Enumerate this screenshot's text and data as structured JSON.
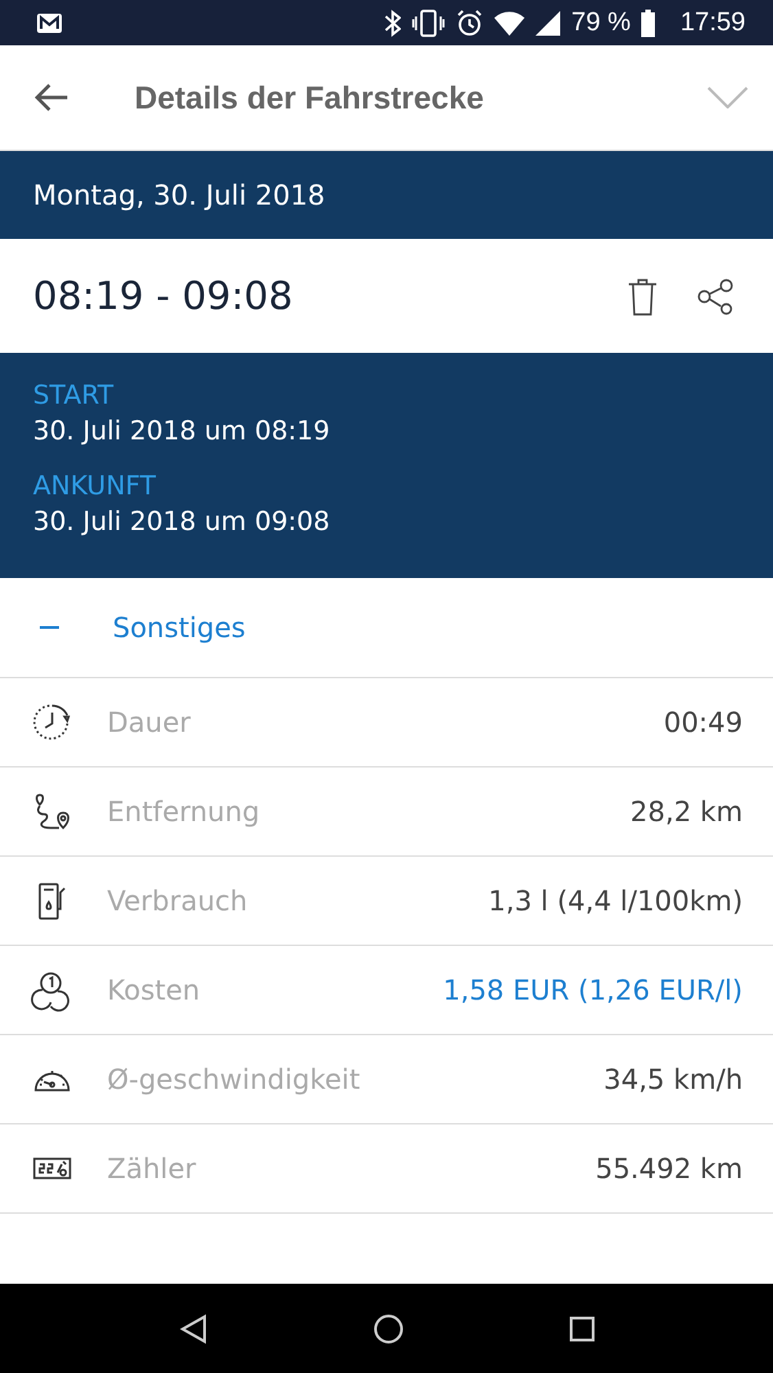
{
  "status_bar": {
    "battery": "79 %",
    "time": "17:59"
  },
  "app_bar": {
    "title": "Details der Fahrstrecke"
  },
  "date": "Montag, 30. Juli 2018",
  "time_range": "08:19 - 09:08",
  "trip": [
    {
      "label": "START",
      "value": "30. Juli 2018 um 08:19"
    },
    {
      "label": "ANKUNFT",
      "value": "30. Juli 2018 um 09:08"
    }
  ],
  "section": {
    "title": "Sonstiges",
    "expanded": true
  },
  "rows": [
    {
      "kind": "duration",
      "label": "Dauer",
      "value": "00:49",
      "highlight": false
    },
    {
      "kind": "distance",
      "label": "Entfernung",
      "value": "28,2 km",
      "highlight": false
    },
    {
      "kind": "fuel",
      "label": "Verbrauch",
      "value": "1,3 l (4,4 l/100km)",
      "highlight": false
    },
    {
      "kind": "cost",
      "label": "Kosten",
      "value": "1,58 EUR (1,26 EUR/l)",
      "highlight": true
    },
    {
      "kind": "speed",
      "label": "Ø-geschwindigkeit",
      "value": "34,5 km/h",
      "highlight": false
    },
    {
      "kind": "odometer",
      "label": "Zähler",
      "value": "55.492 km",
      "highlight": false
    }
  ]
}
